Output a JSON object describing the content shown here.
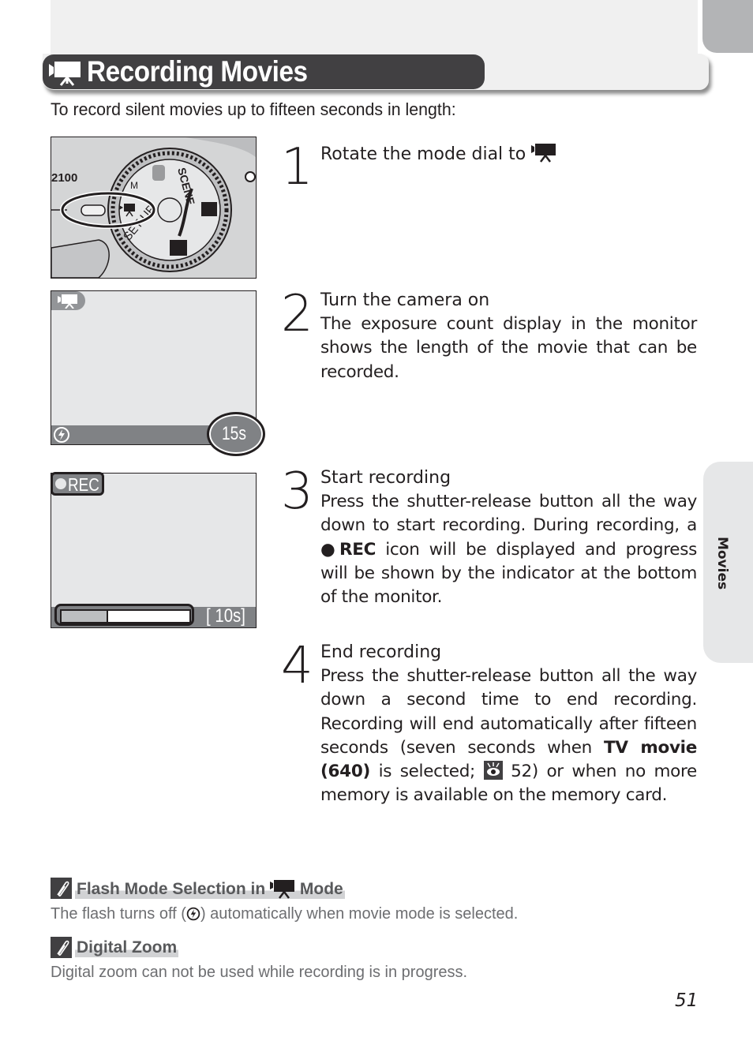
{
  "header": {
    "title": "Recording Movies",
    "title_icon": "movie-camera-icon"
  },
  "intro": "To record silent movies up to fifteen seconds in length:",
  "figures": {
    "mode_dial": {
      "model_label": "2100",
      "dial_labels": [
        "SCENE",
        "SET UP",
        "M"
      ],
      "selected_mode_icon": "movie-camera-icon"
    },
    "monitor_ready": {
      "mode_icon": "movie-camera-icon",
      "flash_icon": "flash-off-icon",
      "remaining": "15s"
    },
    "monitor_recording": {
      "rec_label": "REC",
      "remaining": "10s",
      "progress_fraction": 0.35
    }
  },
  "steps": [
    {
      "number": "1",
      "title": "Rotate the mode dial to",
      "title_icon": "movie-camera-icon",
      "body": ""
    },
    {
      "number": "2",
      "title": "Turn the camera on",
      "body": "The exposure count display in the monitor shows the length of the movie that can be recorded."
    },
    {
      "number": "3",
      "title": "Start recording",
      "body_pre": "Press the shutter-release button all the way down to start recording.  During recording, a ",
      "body_bold": "●REC",
      "body_post": " icon will be displayed and progress will be shown by the indicator at the bottom of the monitor."
    },
    {
      "number": "4",
      "title": "End recording",
      "body_pre": "Press the shutter-release button all the way down a second time to end recording.  Recording will end automatically after fifteen seconds (seven seconds when ",
      "body_bold": "TV movie (640)",
      "body_mid": " is selected; ",
      "ref_icon": "reference-eye-icon",
      "body_post": " 52) or when no more memory is available on the memory card."
    }
  ],
  "notes": [
    {
      "icon": "paperclip-icon",
      "title_pre": "Flash Mode Selection in",
      "title_icon": "movie-camera-icon",
      "title_post": "Mode",
      "body_pre": "The flash turns off (",
      "body_icon": "flash-off-icon",
      "body_post": ") automatically when movie mode is selected."
    },
    {
      "icon": "paperclip-icon",
      "title": "Digital Zoom",
      "body": "Digital zoom can not be used while recording is in progress."
    }
  ],
  "side_tab": "Movies",
  "page_number": "51"
}
